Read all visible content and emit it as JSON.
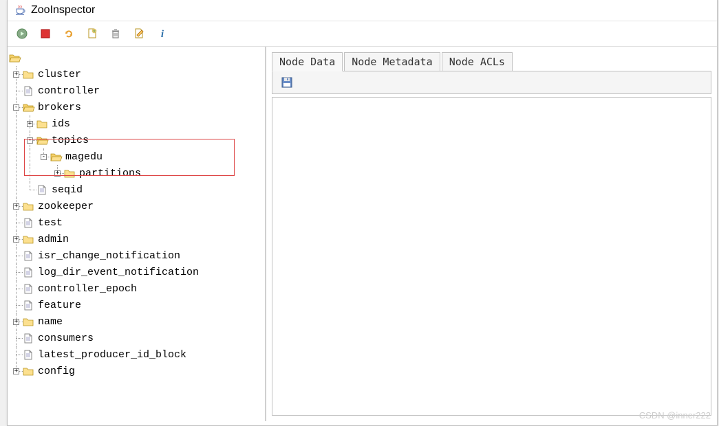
{
  "window": {
    "title": "ZooInspector"
  },
  "toolbar": {
    "connect": "connect",
    "disconnect": "disconnect",
    "refresh": "refresh",
    "add": "add-node",
    "delete": "delete-node",
    "edit": "node-viewers",
    "about": "about"
  },
  "tabs": {
    "data": "Node Data",
    "metadata": "Node Metadata",
    "acls": "Node ACLs"
  },
  "tab_toolbar": {
    "save": "save"
  },
  "tree": {
    "root": "/",
    "cluster": "cluster",
    "controller": "controller",
    "brokers": "brokers",
    "ids": "ids",
    "topics": "topics",
    "magedu": "magedu",
    "partitions": "partitions",
    "seqid": "seqid",
    "zookeeper": "zookeeper",
    "test": "test",
    "admin": "admin",
    "isr": "isr_change_notification",
    "logdir": "log_dir_event_notification",
    "epoch": "controller_epoch",
    "feature": "feature",
    "name": "name",
    "consumers": "consumers",
    "latest": "latest_producer_id_block",
    "config": "config"
  },
  "watermark": "CSDN @inner222"
}
